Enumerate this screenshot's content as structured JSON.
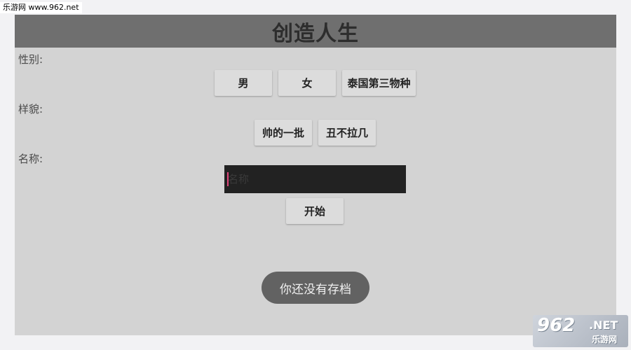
{
  "watermark": {
    "top_text": "乐游网 www.962.net",
    "logo_num_main": "962",
    "logo_net": ".NET",
    "logo_cn": "乐游网"
  },
  "app": {
    "title": "创造人生",
    "gender": {
      "label": "性别:",
      "options": [
        "男",
        "女",
        "泰国第三物种"
      ]
    },
    "appearance": {
      "label": "样貌:",
      "options": [
        "帅的一批",
        "丑不拉几"
      ]
    },
    "name": {
      "label": "名称:",
      "placeholder": "名称",
      "value": ""
    },
    "start_label": "开始",
    "toast": "你还没有存档"
  },
  "colors": {
    "app_bg": "#d3d3d3",
    "titlebar_bg": "#6f6f6f",
    "button_bg": "#dcdcdc",
    "input_bg": "#222222",
    "cursor": "#e0457b",
    "toast_bg": "#626262"
  }
}
